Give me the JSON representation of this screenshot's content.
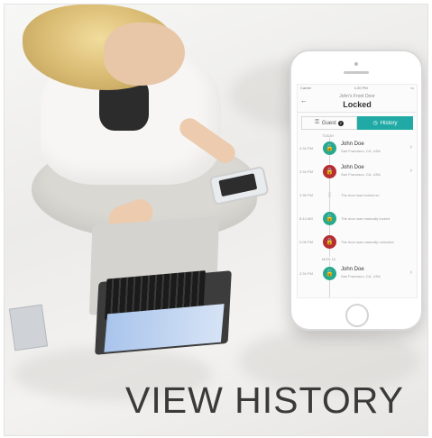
{
  "banner": {
    "headline": "VIEW HISTORY"
  },
  "phone": {
    "status": {
      "carrier": "Carrier",
      "time": "1:20 PM",
      "battery": ""
    },
    "appbar": {
      "door_name": "John's Front Door",
      "door_state": "Locked"
    },
    "tabs": [
      {
        "label": "Guest",
        "badge": "2",
        "icon": "key-icon"
      },
      {
        "label": "History",
        "icon": "clock-icon"
      }
    ],
    "timeline": {
      "day_labels": [
        "TODAY",
        "MON 15"
      ],
      "rows": [
        {
          "time": "2:34 PM",
          "type": "person",
          "state": "unlocked",
          "title": "John Doe",
          "subtitle": "San Francisco, CA, USA"
        },
        {
          "time": "2:34 PM",
          "type": "person",
          "state": "locked",
          "title": "John Doe",
          "subtitle": "San Francisco, CA, USA"
        },
        {
          "time": "1:39 PM",
          "type": "event",
          "state": "neutral",
          "message": "The door was locked on"
        },
        {
          "time": "8:14 AM",
          "type": "event",
          "state": "unlocked",
          "message": "The door was manually locked"
        },
        {
          "time": "2:06 PM",
          "type": "event",
          "state": "locked",
          "message": "The door was manually unlocked"
        },
        {
          "time": "2:34 PM",
          "type": "person",
          "state": "unlocked",
          "title": "John Doe",
          "subtitle": "San Francisco, CA, USA"
        }
      ]
    }
  },
  "colors": {
    "accent_teal": "#21aaa5",
    "locked_red": "#b72d31",
    "unlocked_green": "#27a98e"
  }
}
